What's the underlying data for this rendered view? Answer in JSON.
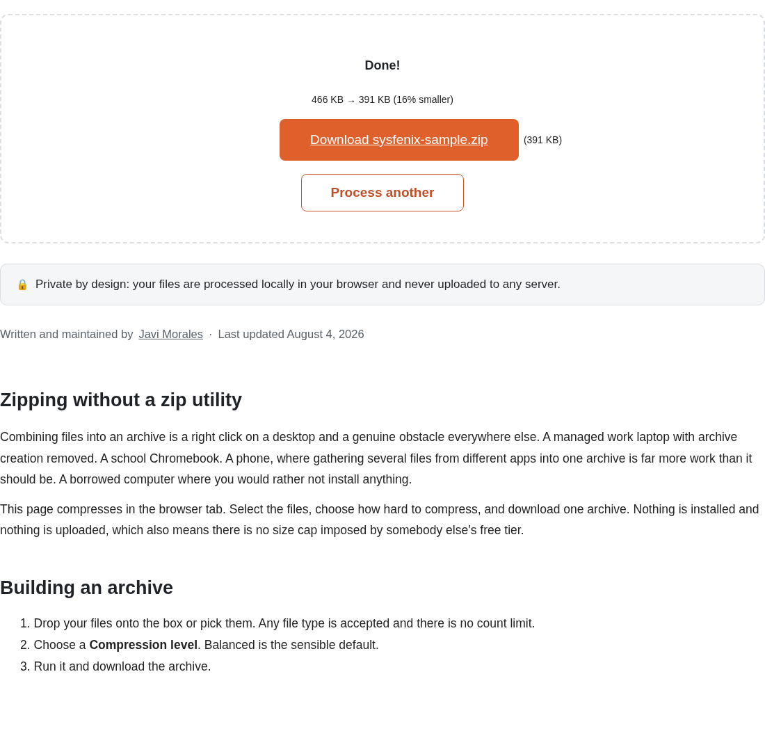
{
  "result": {
    "title": "Done!",
    "summary": "466 KB → 391 KB (16% smaller)",
    "download_button": "Download sysfenix-sample.zip",
    "download_size": "(391 KB)",
    "process_button": "Process another"
  },
  "privacy_note": {
    "icon": "🔒",
    "text": "Private by design: your files are processed locally in your browser and never uploaded to any server."
  },
  "byline": {
    "prefix": "Written and maintained by",
    "author": "Javi Morales",
    "separator": "·",
    "updated": "Last updated August 4, 2026"
  },
  "sections": [
    {
      "heading": "Zipping without a zip utility",
      "paragraphs": [
        "Combining files into an archive is a right click on a desktop and a genuine obstacle everywhere else. A managed work laptop with archive creation removed. A school Chromebook. A phone, where gathering several files from different apps into one archive is far more work than it should be. A borrowed computer where you would rather not install anything.",
        "This page compresses in the browser tab. Select the files, choose how hard to compress, and download one archive. Nothing is installed and nothing is uploaded, which also means there is no size cap imposed by somebody else’s free tier."
      ]
    },
    {
      "heading": "Building an archive",
      "steps": [
        {
          "number": "1.",
          "text": "Drop your files onto the box or pick them. Any file type is accepted and there is no count limit."
        },
        {
          "number": "2.",
          "text": "Choose a **Compression level**. Balanced is the sensible default."
        },
        {
          "number": "3.",
          "text": "Run it and download the archive."
        }
      ]
    }
  ]
}
